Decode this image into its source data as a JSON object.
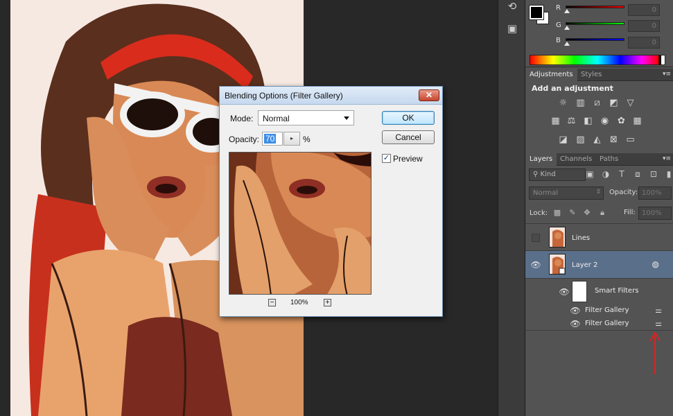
{
  "color_panel": {
    "r_label": "R",
    "g_label": "G",
    "b_label": "B",
    "r_value": "0",
    "g_value": "0",
    "b_value": "0",
    "foreground": "#000000",
    "background": "#ffffff"
  },
  "adjustments": {
    "tabs": [
      "Adjustments",
      "Styles"
    ],
    "title": "Add an adjustment",
    "row1_icons": [
      "brightness-contrast-icon",
      "levels-icon",
      "curves-icon",
      "exposure-icon",
      "vibrance-icon"
    ],
    "row2_icons": [
      "hue-saturation-icon",
      "color-balance-icon",
      "black-white-icon",
      "photo-filter-icon",
      "channel-mixer-icon",
      "color-lookup-icon"
    ],
    "row3_icons": [
      "invert-icon",
      "posterize-icon",
      "threshold-icon",
      "selective-color-icon",
      "gradient-map-icon"
    ]
  },
  "layers": {
    "tabs": [
      "Layers",
      "Channels",
      "Paths"
    ],
    "filter_kind": "Kind",
    "blend_mode": "Normal",
    "opacity_label": "Opacity:",
    "opacity_value": "100%",
    "lock_label": "Lock:",
    "fill_label": "Fill:",
    "fill_value": "100%",
    "items": [
      {
        "name": "Lines"
      },
      {
        "name": "Layer 2"
      },
      {
        "name": "Smart Filters"
      },
      {
        "name": "Filter Gallery"
      },
      {
        "name": "Filter Gallery"
      }
    ]
  },
  "dialog": {
    "title": "Blending Options (Filter Gallery)",
    "close": "✕",
    "mode_label": "Mode:",
    "mode_value": "Normal",
    "opacity_label": "Opacity:",
    "opacity_value": "70",
    "percent": "%",
    "ok": "OK",
    "cancel": "Cancel",
    "preview_label": "Preview",
    "preview_checked": true,
    "zoom_out": "−",
    "zoom_in": "+",
    "zoom_value": "100%"
  },
  "colors": {
    "annotation_arrow": "#e02020",
    "layer_selected": "#5a6f89"
  }
}
